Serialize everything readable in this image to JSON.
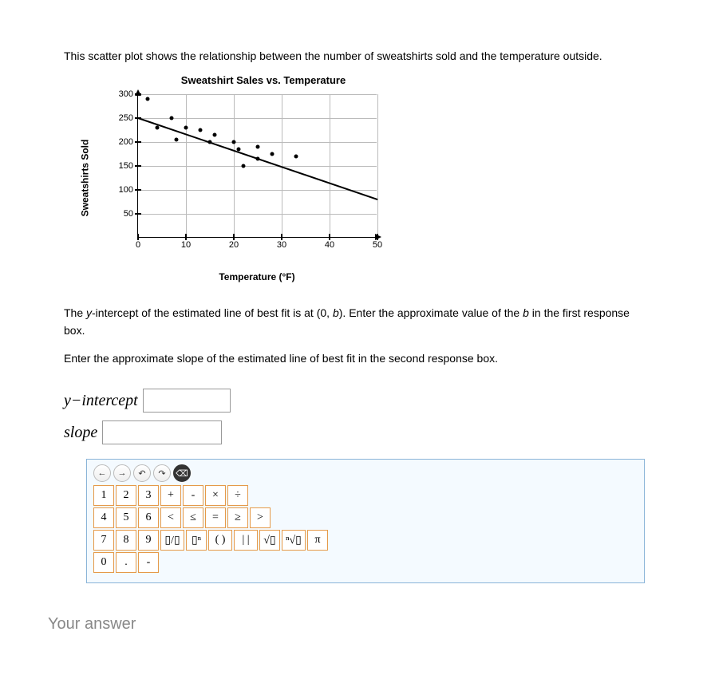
{
  "intro": "This scatter plot shows the relationship between the number of sweatshirts sold and the temperature outside.",
  "chart_data": {
    "type": "scatter",
    "title": "Sweatshirt Sales vs. Temperature",
    "xlabel": "Temperature (°F)",
    "ylabel": "Sweatshirts Sold",
    "xlim": [
      0,
      50
    ],
    "ylim": [
      0,
      300
    ],
    "xticks": [
      0,
      10,
      20,
      30,
      40,
      50
    ],
    "yticks": [
      50,
      100,
      150,
      200,
      250,
      300
    ],
    "points": [
      {
        "x": 2,
        "y": 290
      },
      {
        "x": 4,
        "y": 230
      },
      {
        "x": 7,
        "y": 250
      },
      {
        "x": 8,
        "y": 205
      },
      {
        "x": 10,
        "y": 230
      },
      {
        "x": 13,
        "y": 225
      },
      {
        "x": 15,
        "y": 200
      },
      {
        "x": 16,
        "y": 215
      },
      {
        "x": 20,
        "y": 200
      },
      {
        "x": 21,
        "y": 185
      },
      {
        "x": 22,
        "y": 150
      },
      {
        "x": 25,
        "y": 190
      },
      {
        "x": 25,
        "y": 165
      },
      {
        "x": 28,
        "y": 175
      },
      {
        "x": 33,
        "y": 170
      }
    ],
    "fit_line": {
      "x1": 0,
      "y1": 250,
      "x2": 50,
      "y2": 80
    }
  },
  "question": {
    "p1_a": "The ",
    "p1_b": "y",
    "p1_c": "-intercept of the estimated line of best fit is at (0, ",
    "p1_d": "b",
    "p1_e": "). Enter the approximate value of the ",
    "p1_f": "b",
    "p1_g": " in the first response box.",
    "p2": "Enter the approximate slope of the estimated line of best fit in the second response box."
  },
  "inputs": {
    "intercept_label": "y−intercept",
    "slope_label": "slope"
  },
  "keypad": {
    "toolbar": [
      "←",
      "→",
      "↶",
      "↷",
      "⌫"
    ],
    "row1": [
      "1",
      "2",
      "3",
      "+",
      "-",
      "×",
      "÷"
    ],
    "row2": [
      "4",
      "5",
      "6",
      "<",
      "≤",
      "=",
      "≥",
      ">"
    ],
    "row3": [
      "7",
      "8",
      "9",
      "▯/▯",
      "▯ⁿ",
      "( )",
      "| |",
      "√▯",
      "ⁿ√▯",
      "π"
    ],
    "row4": [
      "0",
      ".",
      "-"
    ]
  },
  "footer": "Your answer"
}
